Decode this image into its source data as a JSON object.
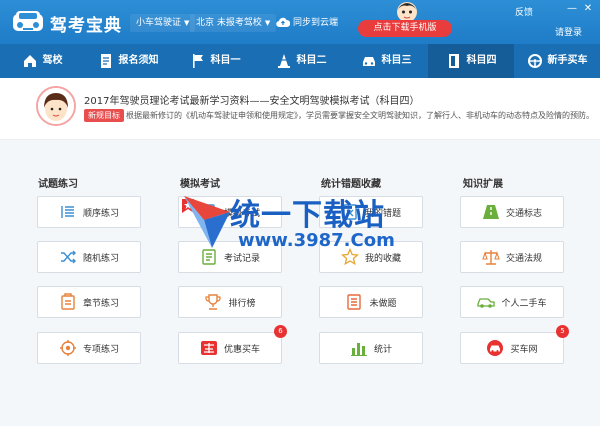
{
  "title_bar": {
    "app_title": "驾考宝典",
    "license_type": "小车驾驶证",
    "region_school": "北京 未报考驾校",
    "cloud_sync": "同步到云端",
    "download_btn": "点击下载手机版",
    "feedback": "反馈",
    "minimize": "—",
    "close": "✕",
    "login": "请登录"
  },
  "nav": [
    {
      "label": "驾校",
      "icon": "home-icon"
    },
    {
      "label": "报名须知",
      "icon": "document-icon"
    },
    {
      "label": "科目一",
      "icon": "flag-icon"
    },
    {
      "label": "科目二",
      "icon": "cone-icon"
    },
    {
      "label": "科目三",
      "icon": "car-icon"
    },
    {
      "label": "科目四",
      "icon": "book-icon",
      "active": true
    },
    {
      "label": "新手买车",
      "icon": "steering-wheel-icon"
    }
  ],
  "announcement": {
    "title": "2017年驾驶员理论考试最新学习资料——安全文明驾驶模拟考试（科目四）",
    "tag": "新规目标",
    "desc": "根据最新修订的《机动车驾驶证申领和使用规定》，学员需要掌握安全文明驾驶知识，了解行人、非机动车的动态特点及险情的预防。"
  },
  "columns": [
    {
      "title": "试题练习",
      "items": [
        {
          "label": "顺序练习",
          "icon": "list-order-icon"
        },
        {
          "label": "随机练习",
          "icon": "shuffle-icon"
        },
        {
          "label": "章节练习",
          "icon": "chapter-icon"
        },
        {
          "label": "专项练习",
          "icon": "target-icon"
        }
      ]
    },
    {
      "title": "模拟考试",
      "items": [
        {
          "label": "模拟考试",
          "icon": "exam-edit-icon"
        },
        {
          "label": "考试记录",
          "icon": "record-icon"
        },
        {
          "label": "排行榜",
          "icon": "trophy-icon"
        },
        {
          "label": "优惠买车",
          "icon": "car-sale-icon",
          "badge": "6"
        }
      ]
    },
    {
      "title": "统计错题收藏",
      "items": [
        {
          "label": "我的错题",
          "icon": "wrong-icon"
        },
        {
          "label": "我的收藏",
          "icon": "star-icon"
        },
        {
          "label": "未做题",
          "icon": "undone-icon"
        },
        {
          "label": "统计",
          "icon": "bar-chart-icon"
        }
      ]
    },
    {
      "title": "知识扩展",
      "items": [
        {
          "label": "交通标志",
          "icon": "road-sign-icon"
        },
        {
          "label": "交通法规",
          "icon": "scale-icon"
        },
        {
          "label": "个人二手车",
          "icon": "used-car-icon"
        },
        {
          "label": "买车网",
          "icon": "car-shop-icon",
          "badge": "5"
        }
      ]
    }
  ],
  "watermark": {
    "text": "统一下载站",
    "url": "www.3987.Com"
  }
}
